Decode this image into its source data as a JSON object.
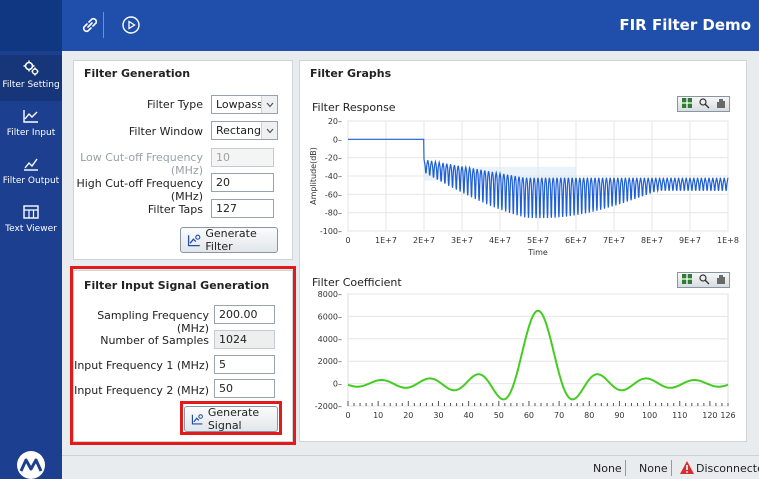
{
  "app_title": "FIR Filter Demo",
  "sidebar": {
    "items": [
      {
        "label": "Filter Setting",
        "icon": "gears-icon"
      },
      {
        "label": "Filter Input",
        "icon": "chart-input-icon"
      },
      {
        "label": "Filter Output",
        "icon": "chart-output-icon"
      },
      {
        "label": "Text Viewer",
        "icon": "table-icon"
      }
    ]
  },
  "filter_generation": {
    "title": "Filter Generation",
    "filter_type_label": "Filter Type",
    "filter_type_value": "Lowpass",
    "filter_window_label": "Filter Window",
    "filter_window_value": "Rectangle",
    "low_cutoff_label": "Low Cut-off Frequency (MHz)",
    "low_cutoff_value": "10",
    "high_cutoff_label": "High Cut-off Frequency (MHz)",
    "high_cutoff_value": "20",
    "taps_label": "Filter Taps",
    "taps_value": "127",
    "generate_button": "Generate Filter"
  },
  "signal_generation": {
    "title": "Filter Input Signal Generation",
    "sampling_label": "Sampling Frequency (MHz)",
    "sampling_value": "200.00",
    "samples_label": "Number of Samples",
    "samples_value": "1024",
    "freq1_label": "Input Frequency 1 (MHz)",
    "freq1_value": "5",
    "freq2_label": "Input Frequency 2 (MHz)",
    "freq2_value": "50",
    "generate_button": "Generate Signal"
  },
  "graphs": {
    "title": "Filter Graphs",
    "response_title": "Filter Response",
    "coeff_title": "Filter Coefficient"
  },
  "status": {
    "item1": "None",
    "item2": "None",
    "connection": "Disconnected"
  },
  "colors": {
    "topbar": "#1f4eab",
    "sidebar": "#1c3f8f",
    "response_line": "#1f5fd6",
    "coeff_line": "#44cc22",
    "highlight": "#e11b1b"
  },
  "chart_data": [
    {
      "type": "line",
      "title": "Filter Response",
      "xlabel": "Time",
      "ylabel": "Amplitude(dB)",
      "x_ticks": [
        "0",
        "1E+7",
        "2E+7",
        "3E+7",
        "4E+7",
        "5E+7",
        "6E+7",
        "7E+7",
        "8E+7",
        "9E+7",
        "1E+8"
      ],
      "y_ticks": [
        "20",
        "0",
        "-20",
        "-40",
        "-60",
        "-80",
        "-100"
      ],
      "xlim": [
        0,
        100000000
      ],
      "ylim": [
        -100,
        20
      ],
      "passband_db": 0,
      "cutoff": 20000000,
      "stopband_floor_db": -50,
      "stopband_ripple_db": [
        -30,
        -90
      ]
    },
    {
      "type": "line",
      "title": "Filter Coefficient",
      "x_ticks": [
        "0",
        "10",
        "20",
        "30",
        "40",
        "50",
        "60",
        "70",
        "80",
        "90",
        "100",
        "110",
        "120",
        "126"
      ],
      "y_ticks": [
        "8000",
        "6000",
        "4000",
        "2000",
        "0",
        "-2000"
      ],
      "xlim": [
        0,
        126
      ],
      "ylim": [
        -2000,
        8000
      ],
      "peak_x": 63,
      "peak_y": 6500
    }
  ]
}
